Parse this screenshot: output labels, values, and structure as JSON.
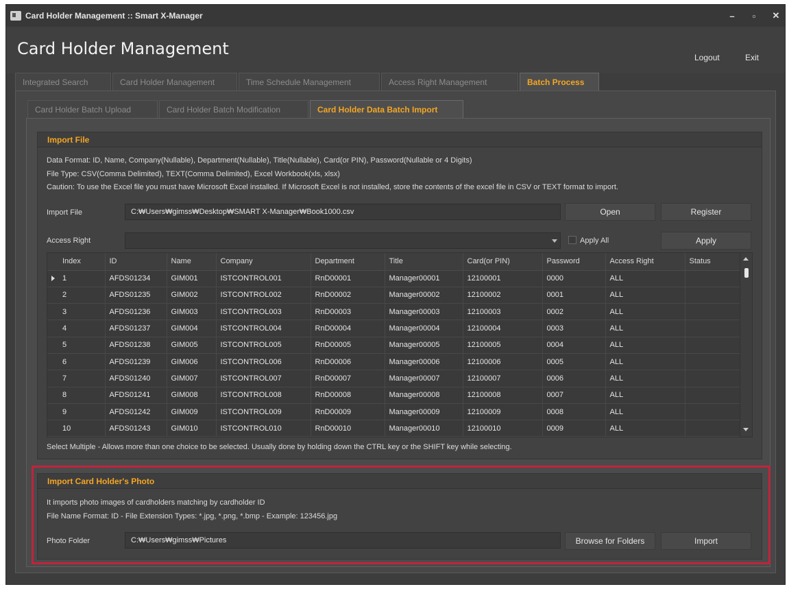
{
  "window": {
    "title": "Card Holder Management :: Smart X-Manager",
    "minimize": "–",
    "maximize": "▫",
    "close": "✕"
  },
  "header": {
    "title": "Card Holder Management",
    "logout": "Logout",
    "exit": "Exit"
  },
  "main_tabs": [
    {
      "label": "Integrated Search",
      "active": false
    },
    {
      "label": "Card Holder Management",
      "active": false
    },
    {
      "label": "Time Schedule Management",
      "active": false
    },
    {
      "label": "Access Right Management",
      "active": false
    },
    {
      "label": "Batch Process",
      "active": true
    }
  ],
  "sub_tabs": [
    {
      "label": "Card Holder Batch Upload",
      "active": false
    },
    {
      "label": "Card Holder Batch Modification",
      "active": false
    },
    {
      "label": "Card Holder Data Batch Import",
      "active": true
    }
  ],
  "import_file": {
    "header": "Import File",
    "data_format": "Data Format: ID, Name, Company(Nullable), Department(Nullable), Title(Nullable), Card(or PIN), Password(Nullable or 4 Digits)",
    "file_type": "File Type: CSV(Comma Delimited), TEXT(Comma Delimited), Excel Workbook(xls, xlsx)",
    "caution": "Caution: To use the Excel file you must have Microsoft Excel installed. If Microsoft Excel is not installed, store the contents of the excel file in CSV or TEXT format to import.",
    "file_label": "Import File",
    "file_path": "C:₩Users₩gimss₩Desktop₩SMART X-Manager₩Book1000.csv",
    "open_label": "Open",
    "register_label": "Register",
    "access_right_label": "Access Right",
    "access_right_value": "",
    "apply_all_label": "Apply All",
    "apply_label": "Apply",
    "footer_note": "Select Multiple - Allows more than one choice to be selected. Usually done by holding down the CTRL key or the SHIFT key while selecting."
  },
  "grid": {
    "columns": [
      "Index",
      "ID",
      "Name",
      "Company",
      "Department",
      "Title",
      "Card(or PIN)",
      "Password",
      "Access Right",
      "Status"
    ],
    "rows": [
      [
        "1",
        "AFDS01234",
        "GIM001",
        "ISTCONTROL001",
        "RnD00001",
        "Manager00001",
        "12100001",
        "0000",
        "ALL",
        ""
      ],
      [
        "2",
        "AFDS01235",
        "GIM002",
        "ISTCONTROL002",
        "RnD00002",
        "Manager00002",
        "12100002",
        "0001",
        "ALL",
        ""
      ],
      [
        "3",
        "AFDS01236",
        "GIM003",
        "ISTCONTROL003",
        "RnD00003",
        "Manager00003",
        "12100003",
        "0002",
        "ALL",
        ""
      ],
      [
        "4",
        "AFDS01237",
        "GIM004",
        "ISTCONTROL004",
        "RnD00004",
        "Manager00004",
        "12100004",
        "0003",
        "ALL",
        ""
      ],
      [
        "5",
        "AFDS01238",
        "GIM005",
        "ISTCONTROL005",
        "RnD00005",
        "Manager00005",
        "12100005",
        "0004",
        "ALL",
        ""
      ],
      [
        "6",
        "AFDS01239",
        "GIM006",
        "ISTCONTROL006",
        "RnD00006",
        "Manager00006",
        "12100006",
        "0005",
        "ALL",
        ""
      ],
      [
        "7",
        "AFDS01240",
        "GIM007",
        "ISTCONTROL007",
        "RnD00007",
        "Manager00007",
        "12100007",
        "0006",
        "ALL",
        ""
      ],
      [
        "8",
        "AFDS01241",
        "GIM008",
        "ISTCONTROL008",
        "RnD00008",
        "Manager00008",
        "12100008",
        "0007",
        "ALL",
        ""
      ],
      [
        "9",
        "AFDS01242",
        "GIM009",
        "ISTCONTROL009",
        "RnD00009",
        "Manager00009",
        "12100009",
        "0008",
        "ALL",
        ""
      ],
      [
        "10",
        "AFDS01243",
        "GIM010",
        "ISTCONTROL010",
        "RnD00010",
        "Manager00010",
        "12100010",
        "0009",
        "ALL",
        ""
      ]
    ]
  },
  "photo_import": {
    "header": "Import Card Holder's Photo",
    "description": "It imports photo images of cardholders matching by cardholder ID",
    "format": "File Name Format: ID - File Extension Types: *.jpg, *.png, *.bmp - Example: 123456.jpg",
    "folder_label": "Photo Folder",
    "folder_path": "C:₩Users₩gimss₩Pictures",
    "browse_label": "Browse for Folders",
    "import_label": "Import"
  },
  "colors": {
    "accent": "#f5a623",
    "highlight": "#c0243c",
    "background": "#3d3d3d"
  }
}
